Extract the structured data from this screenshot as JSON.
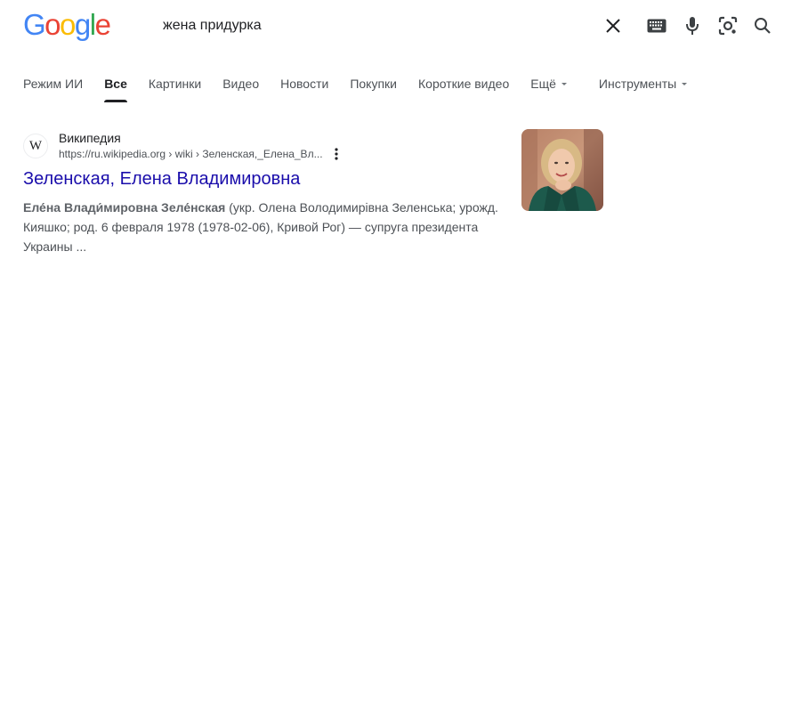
{
  "logo": {
    "letters": [
      "G",
      "o",
      "o",
      "g",
      "l",
      "e"
    ],
    "colors": [
      "#4285F4",
      "#EA4335",
      "#FBBC05",
      "#4285F4",
      "#34A853",
      "#EA4335"
    ]
  },
  "search": {
    "query": "жена придурка"
  },
  "header_icons": [
    "clear-icon",
    "keyboard-icon",
    "microphone-icon",
    "lens-icon",
    "search-icon"
  ],
  "tabs": [
    {
      "label": "Режим ИИ",
      "active": false
    },
    {
      "label": "Все",
      "active": true
    },
    {
      "label": "Картинки",
      "active": false
    },
    {
      "label": "Видео",
      "active": false
    },
    {
      "label": "Новости",
      "active": false
    },
    {
      "label": "Покупки",
      "active": false
    },
    {
      "label": "Короткие видео",
      "active": false
    },
    {
      "label": "Ещё",
      "active": false,
      "dropdown": true
    }
  ],
  "tools": {
    "label": "Инструменты"
  },
  "result": {
    "favicon": "W",
    "site_name": "Википедия",
    "url": "https://ru.wikipedia.org › wiki › Зеленская,_Елена_Вл...",
    "title": "Зеленская, Елена Владимировна",
    "snippet_bold": "Еле́на Влади́мировна Зеле́нская",
    "snippet_rest": " (укр. Олена Володимирівна Зеленська; урожд. Кияшко; род. 6 февраля 1978 (1978-02-06), Кривой Рог) — супруга президента Украины ...",
    "thumbnail": "woman-portrait-thumbnail"
  },
  "colors": {
    "link": "#1a0dab",
    "text": "#202124",
    "secondary": "#4d5156",
    "icon": "#5f6368"
  }
}
